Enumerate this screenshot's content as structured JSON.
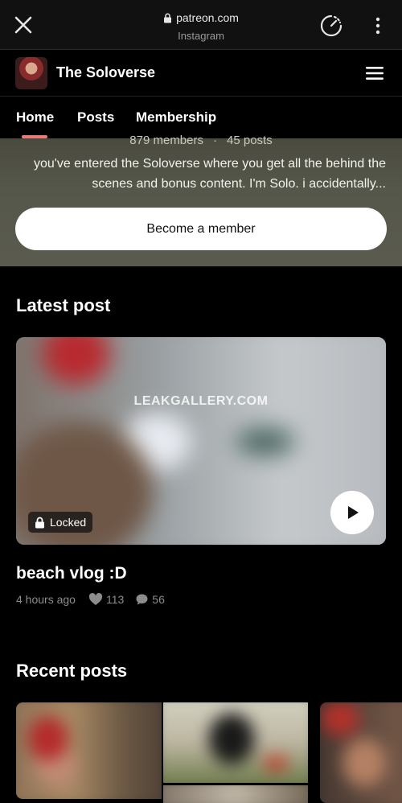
{
  "browser": {
    "url": "patreon.com",
    "site": "Instagram"
  },
  "creator": {
    "name": "The Soloverse"
  },
  "tabs": [
    {
      "label": "Home",
      "active": true
    },
    {
      "label": "Posts",
      "active": false
    },
    {
      "label": "Membership",
      "active": false
    }
  ],
  "hero": {
    "stats_members": "879 members",
    "stats_separator": "·",
    "stats_posts": "45 posts",
    "description": "you've entered the Soloverse where you get all the behind the scenes and bonus content. I'm Solo. i accidentally...",
    "cta_label": "Become a member"
  },
  "latest": {
    "heading": "Latest post",
    "watermark": "LEAKGALLERY.COM",
    "locked_label": "Locked",
    "title": "beach vlog :D",
    "time": "4 hours ago",
    "likes": "113",
    "comments": "56"
  },
  "recent": {
    "heading": "Recent posts"
  },
  "colors": {
    "tab_indicator": "#e87a7a",
    "hero_bg": "#56574b",
    "page_bg": "#000000"
  }
}
